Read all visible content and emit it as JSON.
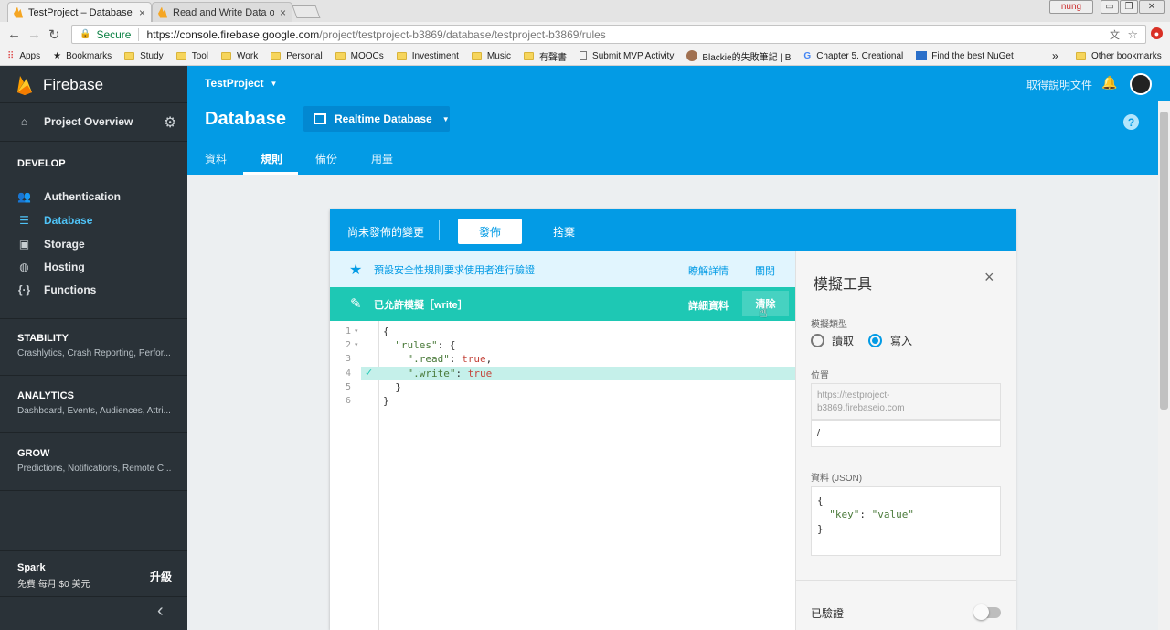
{
  "browser": {
    "tabs": [
      {
        "title": "TestProject – Database -",
        "close": "×"
      },
      {
        "title": "Read and Write Data on",
        "close": "×"
      }
    ],
    "window_user": "nung",
    "security_label": "Secure",
    "url_host": "https://console.firebase.google.com",
    "url_path": "/project/testproject-b3869/database/testproject-b3869/rules",
    "bookmarks": [
      "Apps",
      "Bookmarks",
      "Study",
      "Tool",
      "Work",
      "Personal",
      "MOOCs",
      "Investiment",
      "Music",
      "有聲書",
      "Submit MVP Activity",
      "Blackie的失敗筆記 | B",
      "Chapter 5. Creational",
      "Find the best NuGet"
    ],
    "bookmarks_overflow": "»",
    "other_bookmarks": "Other bookmarks"
  },
  "sidebar": {
    "brand": "Firebase",
    "project_overview": "Project Overview",
    "develop_heading": "DEVELOP",
    "develop_items": [
      {
        "label": "Authentication",
        "icon": "people-icon"
      },
      {
        "label": "Database",
        "icon": "database-icon"
      },
      {
        "label": "Storage",
        "icon": "image-icon"
      },
      {
        "label": "Hosting",
        "icon": "globe-icon"
      },
      {
        "label": "Functions",
        "icon": "functions-icon"
      }
    ],
    "sections": [
      {
        "title": "STABILITY",
        "subtitle": "Crashlytics, Crash Reporting, Perfor..."
      },
      {
        "title": "ANALYTICS",
        "subtitle": "Dashboard, Events, Audiences, Attri..."
      },
      {
        "title": "GROW",
        "subtitle": "Predictions, Notifications, Remote C..."
      }
    ],
    "plan_name": "Spark",
    "plan_price": "免費 每月 $0 美元",
    "upgrade": "升級",
    "collapse": "‹"
  },
  "header": {
    "project": "TestProject",
    "docs_link": "取得說明文件",
    "page_title": "Database",
    "db_selector": "Realtime Database",
    "help": "?",
    "tabs": [
      "資料",
      "規則",
      "備份",
      "用量"
    ]
  },
  "rules_card": {
    "unpublished": "尚未發佈的變更",
    "publish": "發佈",
    "discard": "捨棄",
    "banner1_text": "預設安全性規則要求使用者進行驗證",
    "banner1_learn": "瞭解詳情",
    "banner1_close": "關閉",
    "banner2_text": "已允許模擬［write］",
    "banner2_details": "詳細資料",
    "banner2_clear": "清除",
    "line_numbers": [
      "1",
      "2",
      "3",
      "4",
      "5",
      "6"
    ],
    "code": {
      "l1": "{",
      "l2_key": "\"rules\"",
      "l2_rest": ": {",
      "l3_key": "\".read\"",
      "l3_sep": ": ",
      "l3_val": "true",
      "l3_comma": ",",
      "l4_key": "\".write\"",
      "l4_sep": ": ",
      "l4_val": "true",
      "l5": "}",
      "l6": "}"
    }
  },
  "simulator": {
    "title": "模擬工具",
    "close": "×",
    "type_label": "模擬類型",
    "read": "讀取",
    "write": "寫入",
    "selected_type": "寫入",
    "location_label": "位置",
    "location_prefix": "https://testproject-\nb3869.firebaseio.com",
    "location_value": "/",
    "data_label": "資料 (JSON)",
    "json_l1": "{",
    "json_key": "\"key\"",
    "json_sep": ": ",
    "json_val": "\"value\"",
    "json_l3": "}",
    "authenticated": "已驗證"
  },
  "colors": {
    "firebase_blue": "#039be5",
    "sidebar_bg": "#2a3238",
    "active_nav": "#4fc3f7",
    "sim_banner": "#1ec8b4",
    "info_banner": "#e1f5fe"
  }
}
